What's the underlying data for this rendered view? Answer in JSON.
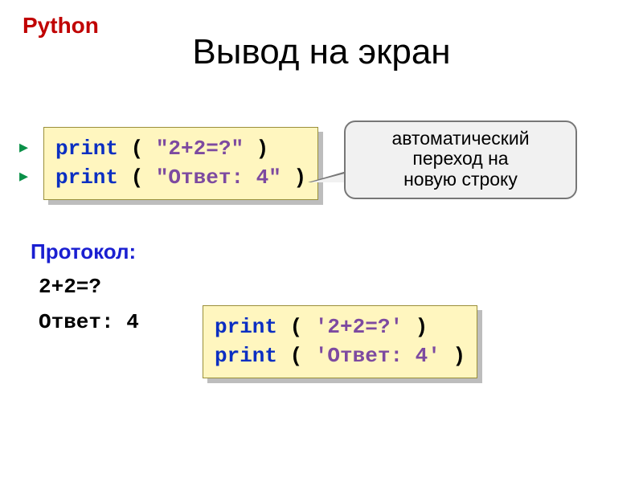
{
  "python_label": "Python",
  "title": "Вывод на экран",
  "callout": {
    "line1": "автоматический",
    "line2": "переход на",
    "line3": "новую строку"
  },
  "code1": {
    "kw": "print",
    "open": " ( ",
    "s1": "\"2+2=?\"",
    "close": " )",
    "s2": "\"Ответ: 4\""
  },
  "code2": {
    "kw": "print",
    "open": " ( ",
    "s1": "'2+2=?'",
    "close": " )",
    "s2": "'Ответ: 4'"
  },
  "protocol_label": "Протокол:",
  "output": {
    "line1": "2+2=?",
    "line2": "Ответ: 4"
  },
  "bullet_glyph": "▸"
}
